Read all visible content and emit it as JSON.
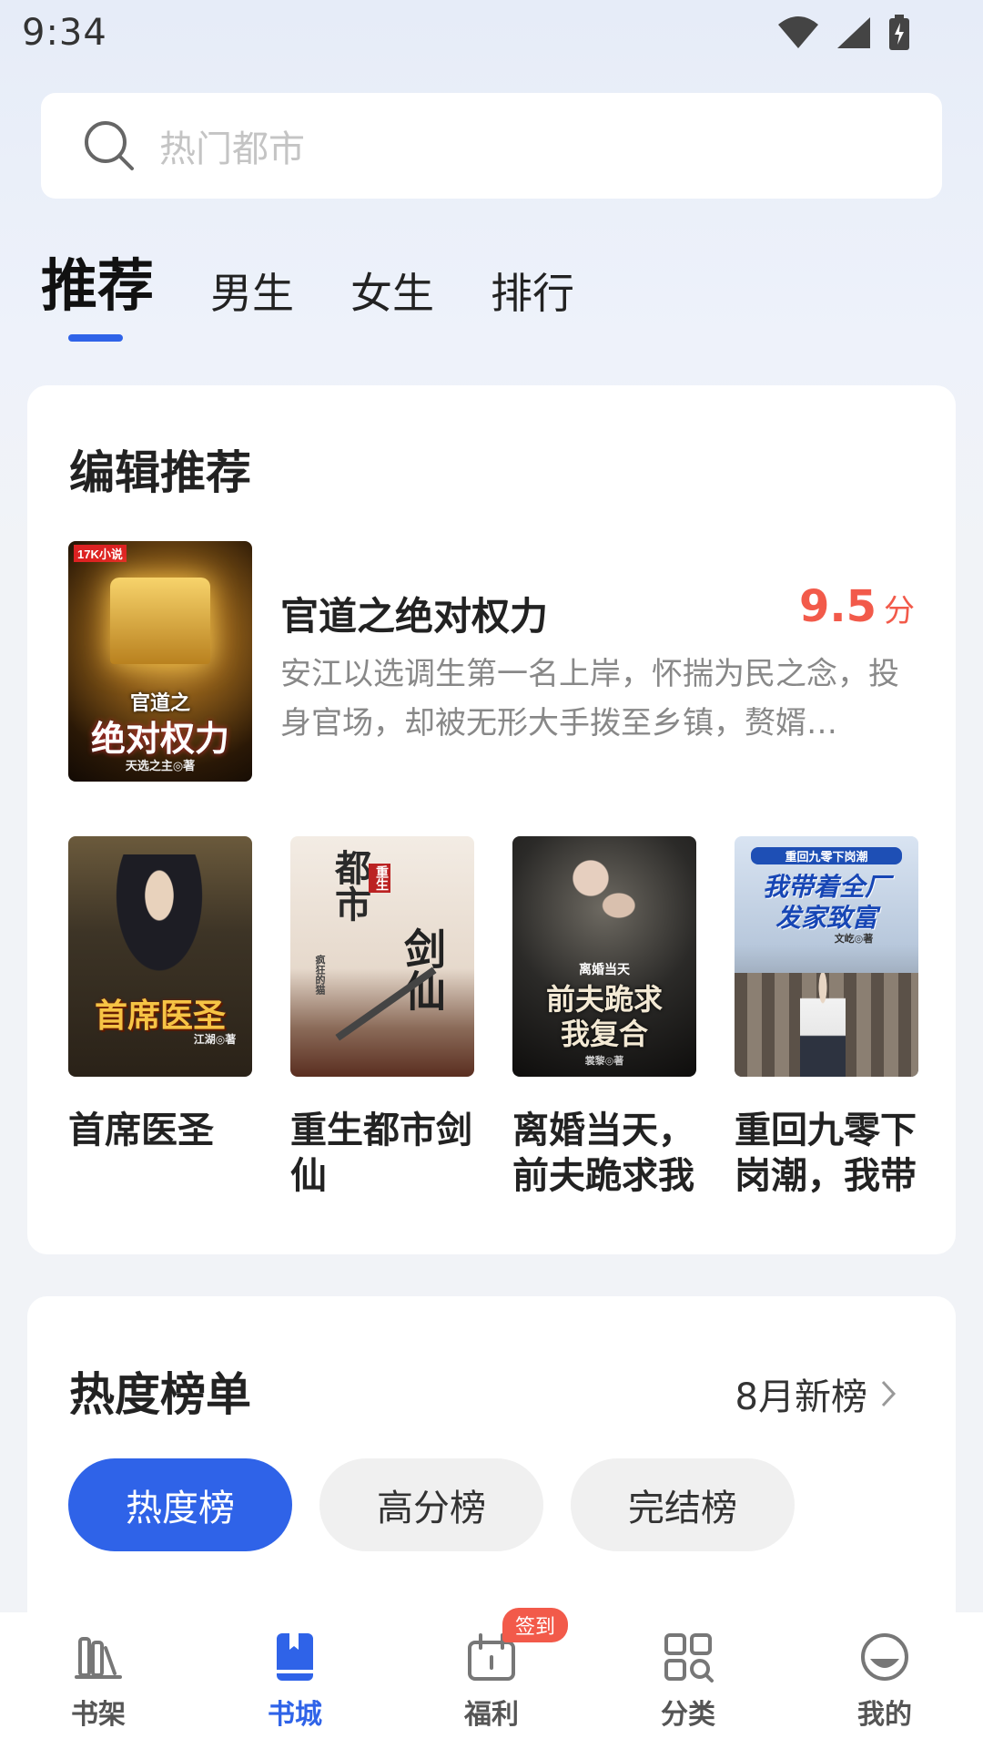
{
  "status": {
    "time": "9:34"
  },
  "search": {
    "placeholder": "热门都市"
  },
  "tabs": [
    "推荐",
    "男生",
    "女生",
    "排行"
  ],
  "editor": {
    "title": "编辑推荐",
    "featured": {
      "title": "官道之绝对权力",
      "score": "9.5",
      "score_unit": "分",
      "description": "安江以选调生第一名上岸，怀揣为民之念，投身官场，却被无形大手拨至乡镇，赘婿…",
      "cover": {
        "line1": "官道之",
        "line2": "绝对权力",
        "author": "天选之主◎著",
        "brand": "17K小说"
      }
    },
    "books": [
      {
        "name": "首席医圣",
        "cover": {
          "line1": "首席医圣",
          "author": "江湖◎著"
        }
      },
      {
        "name": "重生都市剑仙",
        "cover": {
          "line1": "都市",
          "line2": "剑仙",
          "tag": "重生",
          "author": "疯狂的猫"
        }
      },
      {
        "name": "离婚当天，前夫跪求我复合",
        "cover": {
          "tag": "离婚当天",
          "line1": "前夫跪求",
          "line2": "我复合",
          "author": "裳黎◎著"
        }
      },
      {
        "name": "重回九零下岗潮，我带着全厂发家致富",
        "cover": {
          "tag": "重回九零下岗潮",
          "line1": "我带着全厂",
          "line2": "发家致富",
          "author": "文屹◎著"
        }
      }
    ]
  },
  "hot": {
    "title": "热度榜单",
    "more": "8月新榜",
    "pills": [
      "热度榜",
      "高分榜",
      "完结榜"
    ]
  },
  "nav": {
    "items": [
      {
        "label": "书架",
        "icon": "bookshelf-icon"
      },
      {
        "label": "书城",
        "icon": "bookstore-icon"
      },
      {
        "label": "福利",
        "icon": "gift-calendar-icon"
      },
      {
        "label": "分类",
        "icon": "category-grid-icon"
      },
      {
        "label": "我的",
        "icon": "profile-icon"
      }
    ],
    "badge": "签到"
  },
  "colors": {
    "accent": "#2f63e8",
    "score": "#f25a4a"
  }
}
